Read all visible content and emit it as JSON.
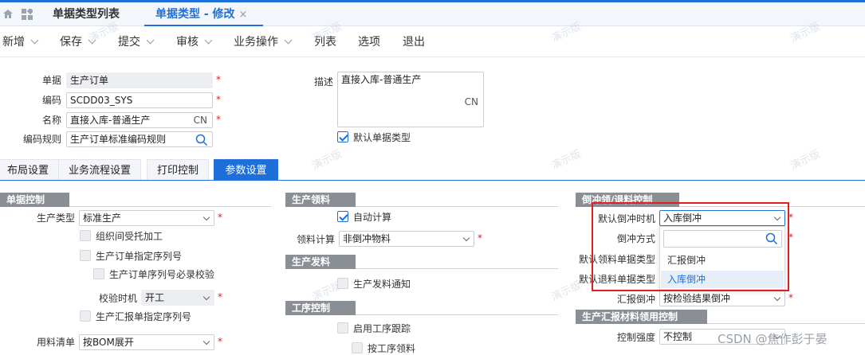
{
  "tabs": {
    "list_title": "单据类型列表",
    "active_title": "单据类型 - 修改",
    "close": "×"
  },
  "toolbar": {
    "new": "新增",
    "save": "保存",
    "submit": "提交",
    "audit": "审核",
    "biz_ops": "业务操作",
    "list": "列表",
    "options": "选项",
    "exit": "退出"
  },
  "header": {
    "doc_label": "单据",
    "doc_value": "生产订单",
    "code_label": "编码",
    "code_value": "SCDD03_SYS",
    "name_label": "名称",
    "name_value": "直接入库-普通生产",
    "name_suffix": "CN",
    "rule_label": "编码规则",
    "rule_value": "生产订单标准编码规则",
    "desc_label": "描述",
    "desc_value": "直接入库-普通生产",
    "desc_suffix": "CN",
    "default_type_label": "默认单据类型"
  },
  "param_tabs": [
    "布局设置",
    "业务流程设置",
    "打印控制",
    "参数设置"
  ],
  "col1": {
    "section": "单据控制",
    "prod_type_label": "生产类型",
    "prod_type_value": "标准生产",
    "outsource": "组织间受托加工",
    "order_seq": "生产订单指定序列号",
    "order_seq_required": "生产订单序列号必录校验",
    "check_time_label": "校验时机",
    "check_time_value": "开工",
    "report_seq": "生产汇报单指定序列号",
    "bom_label": "用料清单",
    "bom_value": "按BOM展开"
  },
  "col2": {
    "sec_pick": "生产领料",
    "auto_calc": "自动计算",
    "pick_calc_label": "领料计算",
    "pick_calc_value": "非倒冲物料",
    "sec_issue": "生产发料",
    "issue_notice": "生产发料通知",
    "sec_route": "工序控制",
    "route_track": "启用工序跟踪",
    "route_pick": "按工序领料"
  },
  "col3": {
    "section": "倒冲领/退料控制",
    "bf_time_label": "默认倒冲时机",
    "bf_time_value": "入库倒冲",
    "bf_method_label": "倒冲方式",
    "bf_pick_type_label": "默认领料单据类型",
    "bf_return_type_label": "默认退料单据类型",
    "report_bf_label": "汇报倒冲",
    "report_bf_value": "按检验结果倒冲",
    "sec_report": "生产汇报材料领用控制",
    "ctrl_label": "控制强度",
    "ctrl_value": "不控制",
    "dropdown_options": [
      "汇报倒冲",
      "入库倒冲"
    ]
  },
  "watermark": "演示版",
  "credit": "CSDN @焦作彭于晏",
  "colors": {
    "accent": "#1e6fd9",
    "highlight_box": "#e02020",
    "required": "#e02020"
  }
}
